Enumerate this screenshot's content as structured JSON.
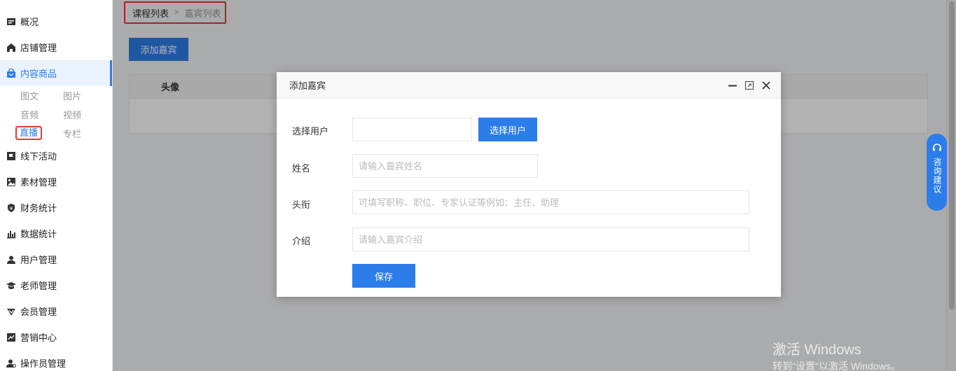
{
  "sidebar": {
    "items": [
      {
        "label": "概况",
        "icon": "dashboard-icon"
      },
      {
        "label": "店铺管理",
        "icon": "store-icon"
      },
      {
        "label": "内容商品",
        "icon": "bag-icon"
      },
      {
        "label": "线下活动",
        "icon": "flag-icon"
      },
      {
        "label": "素材管理",
        "icon": "image-icon"
      },
      {
        "label": "财务统计",
        "icon": "shield-money-icon"
      },
      {
        "label": "数据统计",
        "icon": "bar-chart-icon"
      },
      {
        "label": "用户管理",
        "icon": "user-icon"
      },
      {
        "label": "老师管理",
        "icon": "graduation-cap-icon"
      },
      {
        "label": "会员管理",
        "icon": "vip-icon"
      },
      {
        "label": "营销中心",
        "icon": "trend-icon"
      },
      {
        "label": "操作员管理",
        "icon": "operator-icon"
      }
    ],
    "sub_items": {
      "tuwen": "图文",
      "tupian": "图片",
      "yinpin": "音频",
      "shipin": "视频",
      "zhibo": "直播",
      "zhuanlan": "专栏"
    }
  },
  "breadcrumb": {
    "first": "课程列表",
    "separator": ">",
    "second": "嘉宾列表"
  },
  "main": {
    "add_button": "添加嘉宾",
    "table_header_avatar": "头像"
  },
  "modal": {
    "title": "添加嘉宾",
    "fields": {
      "select_user_label": "选择用户",
      "select_user_value": "",
      "select_user_button": "选择用户",
      "name_label": "姓名",
      "name_placeholder": "请输入嘉宾姓名",
      "title_label": "头衔",
      "title_placeholder": "可填写职称、职位、专家认证等例如：主任、助理",
      "intro_label": "介绍",
      "intro_placeholder": "请输入嘉宾介绍"
    },
    "save_button": "保存"
  },
  "consult": {
    "label": "咨询建议"
  },
  "watermark": {
    "line1": "激活 Windows",
    "line2": "转到\"设置\"以激活 Windows。"
  },
  "colors": {
    "accent": "#2b7de9",
    "highlight_box": "#e53935"
  }
}
